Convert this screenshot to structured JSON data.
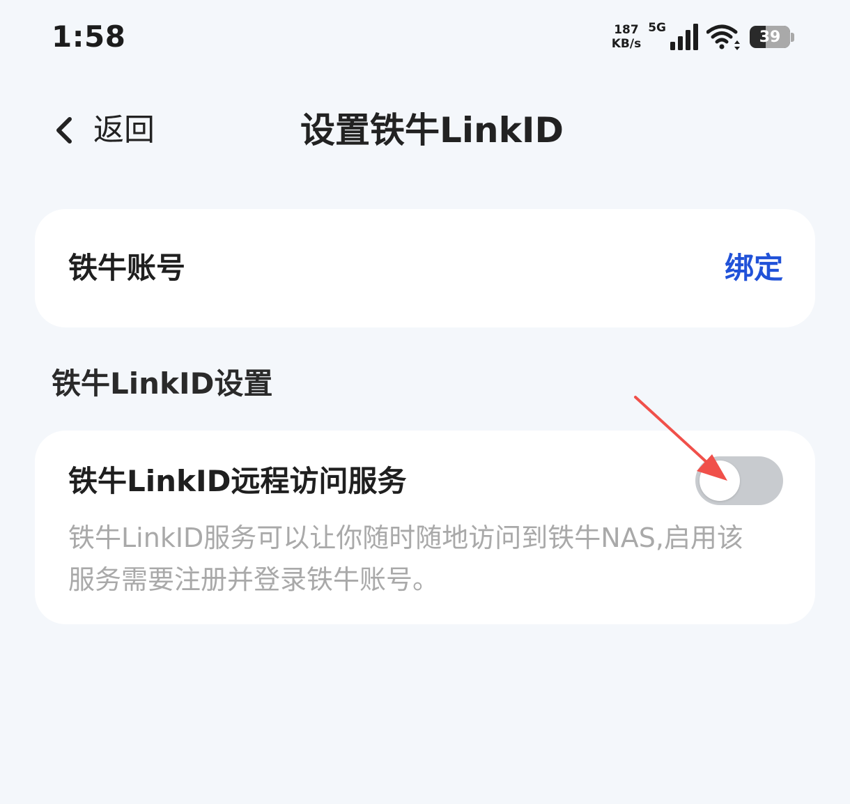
{
  "status_bar": {
    "time": "1:58",
    "net_speed_value": "187",
    "net_speed_unit": "KB/s",
    "network_type": "5G",
    "battery_level": "39",
    "battery_fraction": 0.39,
    "icons": [
      "signal-icon",
      "wifi-icon",
      "battery-icon"
    ]
  },
  "nav": {
    "back_label": "返回",
    "back_icon": "chevron-left-icon",
    "title": "设置铁牛LinkID"
  },
  "account_card": {
    "label": "铁牛账号",
    "action_label": "绑定",
    "action_color": "#2152d8"
  },
  "settings_section": {
    "title": "铁牛LinkID设置",
    "remote_service": {
      "label": "铁牛LinkID远程访问服务",
      "description": "铁牛LinkID服务可以让你随时随地访问到铁牛NAS,启用该服务需要注册并登录铁牛账号。",
      "enabled": false
    }
  },
  "annotation": {
    "icon": "red-arrow",
    "color": "#f0504a"
  }
}
